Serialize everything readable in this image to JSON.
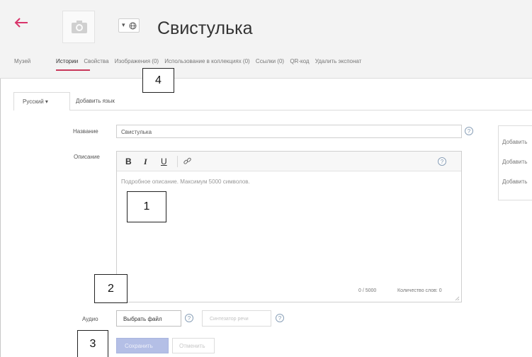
{
  "header": {
    "title": "Свистулька",
    "museum_link": "Музей",
    "tabs": [
      {
        "label": "Истории",
        "active": true
      },
      {
        "label": "Свойства"
      },
      {
        "label": "Изображения (0)"
      },
      {
        "label": "Использование в коллекциях (0)"
      },
      {
        "label": "Ссылки (0)"
      },
      {
        "label": "QR-код"
      },
      {
        "label": "Удалить экспонат"
      }
    ],
    "accent_color": "#c8375a"
  },
  "language": {
    "current": "Русский",
    "caret": "▾",
    "add_label": "Добавить язык"
  },
  "form": {
    "name_label": "Название",
    "name_value": "Свистулька",
    "description_label": "Описание",
    "toolbar": {
      "bold": "B",
      "italic": "I",
      "underline": "U"
    },
    "description_placeholder": "Подробное описание. Максимум 5000 символов.",
    "char_counter": "0 / 5000",
    "word_count": "Количество слов: 0",
    "audio_label": "Аудио",
    "choose_file": "Выбрать файл",
    "tts_button": "Синтезатор речи",
    "save": "Сохранить",
    "cancel": "Отменить",
    "help_glyph": "?"
  },
  "side_panel": {
    "items": [
      "Добавить",
      "Добавить",
      "Добавить"
    ]
  },
  "annotations": [
    "1",
    "2",
    "3",
    "4"
  ],
  "icons": {
    "back": "back-arrow-icon",
    "photo": "camera-icon",
    "language": "globe-icon",
    "link": "link-icon"
  }
}
